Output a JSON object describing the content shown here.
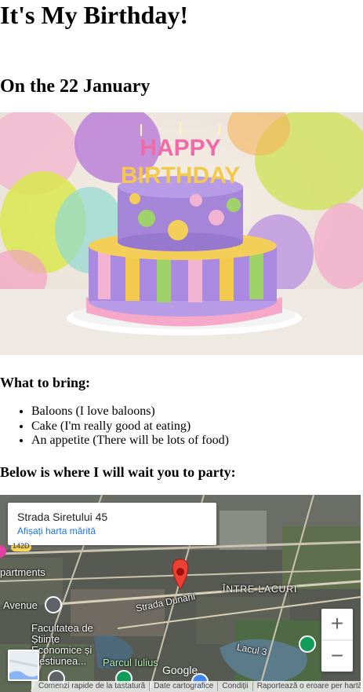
{
  "page": {
    "title": "It's My Birthday!",
    "date_heading": "On the 22 January"
  },
  "hero": {
    "cake_topper_line1": "HAPPY",
    "cake_topper_line2": "BIRTHDAY"
  },
  "bring": {
    "title": "What to bring:",
    "items": [
      "Baloons (I love baloons)",
      "Cake (I'm really good at eating)",
      "An appetite (There will be lots of food)"
    ]
  },
  "party": {
    "title": "Below is where I will wait you to party:"
  },
  "map": {
    "card_address": "Strada Siretului 45",
    "card_link": "Afișați harta mărită",
    "labels": {
      "road_badge": "142D",
      "apartments": "partments",
      "avenue": "Avenue",
      "street": "Strada Dunării",
      "district": "ÎNTRE LACURI",
      "faculty": "Facultatea de Științe Economice și Gestiunea...",
      "park": "Parcul Iulius",
      "lake": "Lacul 3"
    },
    "zoom_in": "+",
    "zoom_out": "−",
    "logo": "Google",
    "attribution": [
      "Comenzi rapide de la tastatură",
      "Date cartografice",
      "Condiții",
      "Raportează o eroare per hartă"
    ]
  }
}
